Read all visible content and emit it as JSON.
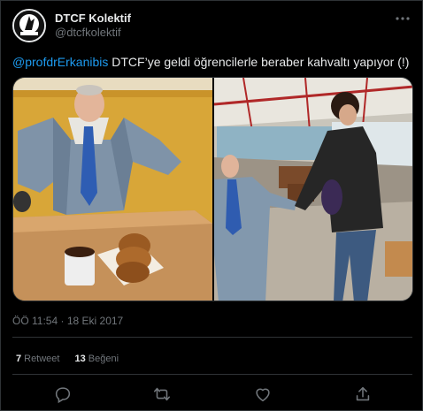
{
  "author": {
    "name": "DTCF Kolektif",
    "handle": "@dtcfkolektif",
    "avatar_icon": "dtcf-logo-icon"
  },
  "tweet": {
    "mention": "@profdrErkanibis",
    "text": " DTCF’ye geldi öğrencilerle beraber kahvaltı yapıyor (!)"
  },
  "media": {
    "images": [
      "cutout-breakfast-photo",
      "cutout-handshake-photo"
    ]
  },
  "meta": {
    "time": "ÖÖ 11:54",
    "separator": "·",
    "date": "18 Eki 2017"
  },
  "stats": {
    "retweet_count": "7",
    "retweet_label": "Retweet",
    "like_count": "13",
    "like_label": "Beğeni"
  },
  "actions": [
    "reply-icon",
    "retweet-icon",
    "like-icon",
    "share-icon"
  ],
  "colors": {
    "accent": "#1d9bf0",
    "text": "#e7e9ea",
    "muted": "#71767b",
    "border": "#2f3336",
    "background": "#000000"
  }
}
